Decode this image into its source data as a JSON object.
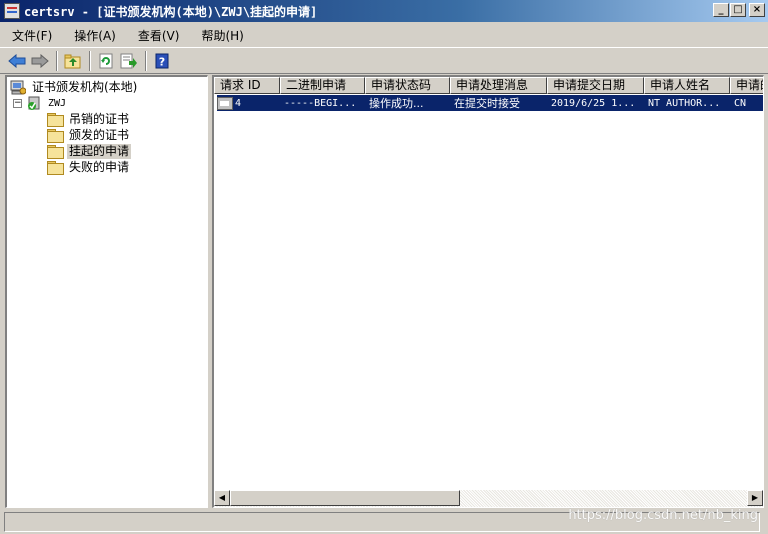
{
  "window": {
    "title": "certsrv - [证书颁发机构(本地)\\ZWJ\\挂起的申请]"
  },
  "menu": [
    {
      "label": "文件(F)"
    },
    {
      "label": "操作(A)"
    },
    {
      "label": "查看(V)"
    },
    {
      "label": "帮助(H)"
    }
  ],
  "toolbar": {
    "icons": [
      "back-arrow-icon",
      "forward-arrow-icon",
      "up-folder-icon",
      "refresh-icon",
      "export-list-icon",
      "help-icon"
    ]
  },
  "tree": {
    "root": "证书颁发机构(本地)",
    "ca": "ZWJ",
    "expander": "−",
    "folders": [
      {
        "label": "吊销的证书"
      },
      {
        "label": "颁发的证书"
      },
      {
        "label": "挂起的申请"
      },
      {
        "label": "失败的申请"
      }
    ]
  },
  "list": {
    "columns": [
      "请求 ID",
      "二进制申请",
      "申请状态码",
      "申请处理消息",
      "申请提交日期",
      "申请人姓名",
      "申请的"
    ],
    "rows": [
      [
        "4",
        "-----BEGI...",
        "操作成功...",
        "在提交时接受",
        "2019/6/25 1...",
        "NT AUTHOR...",
        "CN"
      ]
    ]
  },
  "scrollbar": {
    "left_arrow": "◀",
    "right_arrow": "▶"
  },
  "watermark": "https://blog.csdn.net/nb_king",
  "colors": {
    "title_gradient_start": "#0a246a",
    "selection": "#0a246a",
    "face": "#d4d0c8"
  }
}
